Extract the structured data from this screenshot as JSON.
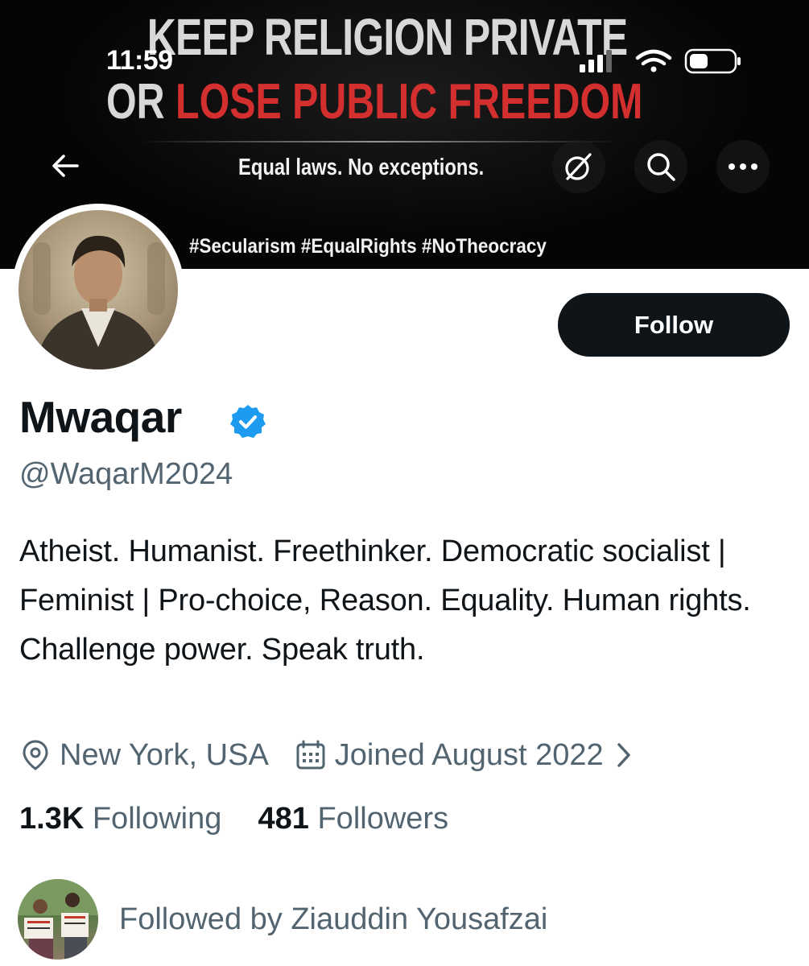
{
  "status_bar": {
    "time": "11:59"
  },
  "banner": {
    "headline_line1": "KEEP RELIGION PRIVATE",
    "headline_line2_prefix": "OR ",
    "headline_line2_red": "LOSE PUBLIC FREEDOM",
    "tagline": "Equal laws. No exceptions.",
    "hashtags": "#Secularism #EqualRights #NoTheocracy"
  },
  "nav": {
    "back_icon": "arrow-left-icon",
    "grok_icon": "grok-icon",
    "search_icon": "search-icon",
    "more_icon": "more-horizontal-icon"
  },
  "profile": {
    "follow_label": "Follow",
    "display_name": "Mwaqar",
    "handle": "@WaqarM2024",
    "bio": "Atheist. Humanist. Freethinker. Democratic socialist | Feminist | Pro-choice, Reason. Equality. Human rights. Challenge power. Speak truth.",
    "location": "New York, USA",
    "joined": "Joined August 2022",
    "following_count": "1.3K",
    "following_label": "Following",
    "followers_count": "481",
    "followers_label": "Followers",
    "followed_by": "Followed by Ziauddin Yousafzai"
  },
  "colors": {
    "text_primary": "#0f1419",
    "text_secondary": "#536471",
    "verified_blue": "#1d9bf0",
    "banner_red": "#d32f2f"
  }
}
